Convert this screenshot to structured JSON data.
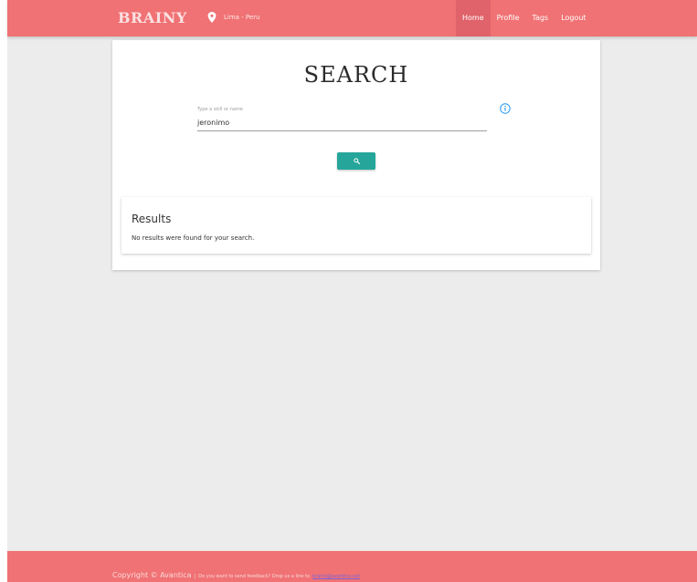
{
  "navbar": {
    "brand": "BRAINY",
    "location": "Lima - Peru",
    "links": [
      {
        "label": "Home",
        "active": true
      },
      {
        "label": "Profile"
      },
      {
        "label": "Tags"
      },
      {
        "label": "Logout"
      }
    ],
    "color": "#f07274"
  },
  "search": {
    "title": "SEARCH",
    "label": "Type a skill or name",
    "value": "jeronimo",
    "button_icon": "search-icon",
    "button_color": "#26a69a"
  },
  "results": {
    "title": "Results",
    "message": "No results were found for your search."
  },
  "footer": {
    "copyright": "Copyright © Avantica",
    "separator": "|",
    "feedback": "Do you want to send feedback? Drop us a line to",
    "email": "brainy@avantica.net"
  }
}
